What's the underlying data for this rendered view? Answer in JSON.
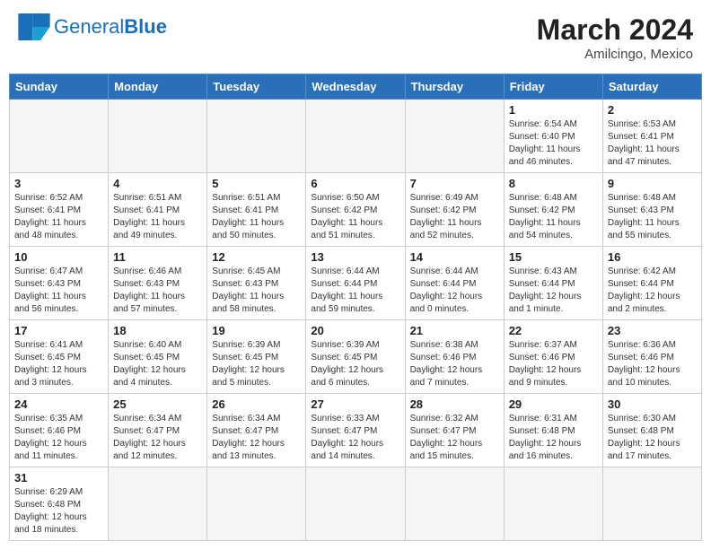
{
  "header": {
    "logo_general": "General",
    "logo_blue": "Blue",
    "month_year": "March 2024",
    "location": "Amilcingo, Mexico"
  },
  "weekdays": [
    "Sunday",
    "Monday",
    "Tuesday",
    "Wednesday",
    "Thursday",
    "Friday",
    "Saturday"
  ],
  "weeks": [
    [
      {
        "day": "",
        "info": ""
      },
      {
        "day": "",
        "info": ""
      },
      {
        "day": "",
        "info": ""
      },
      {
        "day": "",
        "info": ""
      },
      {
        "day": "",
        "info": ""
      },
      {
        "day": "1",
        "info": "Sunrise: 6:54 AM\nSunset: 6:40 PM\nDaylight: 11 hours and 46 minutes."
      },
      {
        "day": "2",
        "info": "Sunrise: 6:53 AM\nSunset: 6:41 PM\nDaylight: 11 hours and 47 minutes."
      }
    ],
    [
      {
        "day": "3",
        "info": "Sunrise: 6:52 AM\nSunset: 6:41 PM\nDaylight: 11 hours and 48 minutes."
      },
      {
        "day": "4",
        "info": "Sunrise: 6:51 AM\nSunset: 6:41 PM\nDaylight: 11 hours and 49 minutes."
      },
      {
        "day": "5",
        "info": "Sunrise: 6:51 AM\nSunset: 6:41 PM\nDaylight: 11 hours and 50 minutes."
      },
      {
        "day": "6",
        "info": "Sunrise: 6:50 AM\nSunset: 6:42 PM\nDaylight: 11 hours and 51 minutes."
      },
      {
        "day": "7",
        "info": "Sunrise: 6:49 AM\nSunset: 6:42 PM\nDaylight: 11 hours and 52 minutes."
      },
      {
        "day": "8",
        "info": "Sunrise: 6:48 AM\nSunset: 6:42 PM\nDaylight: 11 hours and 54 minutes."
      },
      {
        "day": "9",
        "info": "Sunrise: 6:48 AM\nSunset: 6:43 PM\nDaylight: 11 hours and 55 minutes."
      }
    ],
    [
      {
        "day": "10",
        "info": "Sunrise: 6:47 AM\nSunset: 6:43 PM\nDaylight: 11 hours and 56 minutes."
      },
      {
        "day": "11",
        "info": "Sunrise: 6:46 AM\nSunset: 6:43 PM\nDaylight: 11 hours and 57 minutes."
      },
      {
        "day": "12",
        "info": "Sunrise: 6:45 AM\nSunset: 6:43 PM\nDaylight: 11 hours and 58 minutes."
      },
      {
        "day": "13",
        "info": "Sunrise: 6:44 AM\nSunset: 6:44 PM\nDaylight: 11 hours and 59 minutes."
      },
      {
        "day": "14",
        "info": "Sunrise: 6:44 AM\nSunset: 6:44 PM\nDaylight: 12 hours and 0 minutes."
      },
      {
        "day": "15",
        "info": "Sunrise: 6:43 AM\nSunset: 6:44 PM\nDaylight: 12 hours and 1 minute."
      },
      {
        "day": "16",
        "info": "Sunrise: 6:42 AM\nSunset: 6:44 PM\nDaylight: 12 hours and 2 minutes."
      }
    ],
    [
      {
        "day": "17",
        "info": "Sunrise: 6:41 AM\nSunset: 6:45 PM\nDaylight: 12 hours and 3 minutes."
      },
      {
        "day": "18",
        "info": "Sunrise: 6:40 AM\nSunset: 6:45 PM\nDaylight: 12 hours and 4 minutes."
      },
      {
        "day": "19",
        "info": "Sunrise: 6:39 AM\nSunset: 6:45 PM\nDaylight: 12 hours and 5 minutes."
      },
      {
        "day": "20",
        "info": "Sunrise: 6:39 AM\nSunset: 6:45 PM\nDaylight: 12 hours and 6 minutes."
      },
      {
        "day": "21",
        "info": "Sunrise: 6:38 AM\nSunset: 6:46 PM\nDaylight: 12 hours and 7 minutes."
      },
      {
        "day": "22",
        "info": "Sunrise: 6:37 AM\nSunset: 6:46 PM\nDaylight: 12 hours and 9 minutes."
      },
      {
        "day": "23",
        "info": "Sunrise: 6:36 AM\nSunset: 6:46 PM\nDaylight: 12 hours and 10 minutes."
      }
    ],
    [
      {
        "day": "24",
        "info": "Sunrise: 6:35 AM\nSunset: 6:46 PM\nDaylight: 12 hours and 11 minutes."
      },
      {
        "day": "25",
        "info": "Sunrise: 6:34 AM\nSunset: 6:47 PM\nDaylight: 12 hours and 12 minutes."
      },
      {
        "day": "26",
        "info": "Sunrise: 6:34 AM\nSunset: 6:47 PM\nDaylight: 12 hours and 13 minutes."
      },
      {
        "day": "27",
        "info": "Sunrise: 6:33 AM\nSunset: 6:47 PM\nDaylight: 12 hours and 14 minutes."
      },
      {
        "day": "28",
        "info": "Sunrise: 6:32 AM\nSunset: 6:47 PM\nDaylight: 12 hours and 15 minutes."
      },
      {
        "day": "29",
        "info": "Sunrise: 6:31 AM\nSunset: 6:48 PM\nDaylight: 12 hours and 16 minutes."
      },
      {
        "day": "30",
        "info": "Sunrise: 6:30 AM\nSunset: 6:48 PM\nDaylight: 12 hours and 17 minutes."
      }
    ],
    [
      {
        "day": "31",
        "info": "Sunrise: 6:29 AM\nSunset: 6:48 PM\nDaylight: 12 hours and 18 minutes."
      },
      {
        "day": "",
        "info": ""
      },
      {
        "day": "",
        "info": ""
      },
      {
        "day": "",
        "info": ""
      },
      {
        "day": "",
        "info": ""
      },
      {
        "day": "",
        "info": ""
      },
      {
        "day": "",
        "info": ""
      }
    ]
  ]
}
